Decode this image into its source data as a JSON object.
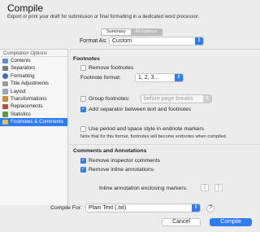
{
  "dialog": {
    "title": "Compile",
    "subtitle": "Export or print your draft for submission or final formatting in a dedicated word processor."
  },
  "view_tabs": [
    {
      "label": "Summary",
      "selected": false
    },
    {
      "label": "All Options",
      "selected": true
    }
  ],
  "format_as": {
    "label": "Format As:",
    "value": "Custom"
  },
  "sidebar": {
    "heading": "Compilation Options",
    "items": [
      {
        "label": "Contents",
        "icon": "contents-icon",
        "color": "#5a8fd8"
      },
      {
        "label": "Separators",
        "icon": "separators-icon",
        "color": "#7a7a7a"
      },
      {
        "label": "Formatting",
        "icon": "formatting-icon",
        "color": "#3d6fb6"
      },
      {
        "label": "Title Adjustments",
        "icon": "title-adjustments-icon",
        "color": "#9a9a9a"
      },
      {
        "label": "Layout",
        "icon": "layout-icon",
        "color": "#9aa8b8"
      },
      {
        "label": "Transformations",
        "icon": "transformations-icon",
        "color": "#d9892b"
      },
      {
        "label": "Replacements",
        "icon": "replacements-icon",
        "color": "#c4473a"
      },
      {
        "label": "Statistics",
        "icon": "statistics-icon",
        "color": "#5b9b4a"
      },
      {
        "label": "Footnotes & Comments",
        "icon": "footnotes-icon",
        "color": "#f0c23a",
        "selected": true
      }
    ]
  },
  "footnotes": {
    "title": "Footnotes",
    "remove_footnotes": {
      "label": "Remove footnotes",
      "checked": false
    },
    "format_label": "Footnote format:",
    "format_value": "1, 2, 3...",
    "group_footnotes": {
      "label": "Group footnotes:",
      "checked": false,
      "value": "before page breaks"
    },
    "add_separator": {
      "label": "Add separator between text and footnotes",
      "checked": true
    },
    "endnote_markers": {
      "label": "Use period and space style in endnote markers",
      "checked": false
    },
    "note": "Note that for this format, footnotes will become endnotes when compiled."
  },
  "comments": {
    "title": "Comments and Annotations",
    "remove_inspector": {
      "label": "Remove inspector comments",
      "checked": true
    },
    "remove_inline": {
      "label": "Remove inline annotations",
      "checked": true
    },
    "markers_label": "Inline annotation enclosing markers:",
    "marker_open": "{",
    "marker_close": "}"
  },
  "compile_for": {
    "label": "Compile For:",
    "value": "Plain Text (.txt)"
  },
  "help_label": "?",
  "buttons": {
    "cancel": "Cancel",
    "compile": "Compile"
  },
  "colors": {
    "accent": "#2f7df6"
  }
}
